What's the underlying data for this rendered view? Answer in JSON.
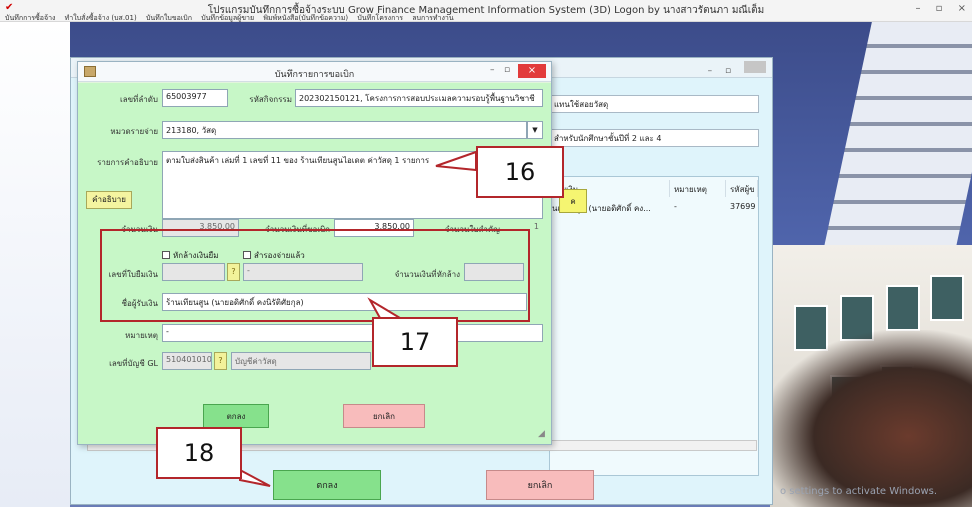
{
  "app": {
    "title": "โปรแกรมบันทึกการซื้อจ้างระบบ Grow Finance Management Information System (3D) Logon by นางสาวรัตนภา มณีเต็ม",
    "menu": [
      "บันทึกการซื้อจ้าง",
      "ทำใบสั่งซื้อจ้าง (บส.01)",
      "บันทึกใบขอเบิก",
      "บันทึกข้อมูลผู้ขาย",
      "พิมพ์หนังสือ(บันทึกข้อความ)",
      "บันทึกโครงการ",
      "ลบการทำงาน"
    ],
    "window_controls": [
      "–",
      "▫",
      "×"
    ]
  },
  "main_window": {
    "fields": [
      "แทนใช้สอยวัสดุ",
      "สำหรับนักศึกษาชั้นปีที่ 2 และ 4"
    ],
    "yellow_button": "ค",
    "table_headers": [
      "ผู้รับเงิน",
      "หมายเหตุ",
      "รหัสผู้ข"
    ],
    "table_row": [
      "นเทียนสูน (นายอดิศักดิ์ คง...",
      "-",
      "37699"
    ],
    "ok_label": "ตกลง",
    "cancel_label": "ยกเลิก",
    "watermark": "o settings to activate Windows."
  },
  "dialog": {
    "title": "บันทึกรายการขอเบิก",
    "controls": {
      "min": "–",
      "max": "▫",
      "close": "×"
    },
    "seq_label": "เลขที่ลำดับ",
    "seq_value": "65003977",
    "activity_label": "รหัสกิจกรรม",
    "activity_value": "202302150121, โครงการการสอบประเมลความรอบรู้พื้นฐานวิชาชี",
    "expense_label": "หมวดรายจ่าย",
    "expense_value": "213180, วัสดุ",
    "desc_label": "รายการคำอธิบาย",
    "desc_value": "ตามใบส่งสินค้า เล่มที่ 1  เลขที่ 11  ของ ร้านเทียนสูนไอเดต  ค่าวัสดุ 1 รายการ",
    "desc_button": "คำอธิบาย",
    "amount_label": "จำนวนเงิน",
    "amount_value": "3,850.00",
    "request_label": "จำนวนเงินที่ขอเบิก",
    "request_value": "3,850.00",
    "receipts_label": "จำนวนใบสำคัญ",
    "receipts_value": "1",
    "advance_check_label": "หักล้างเงินยืม",
    "paid_check_label": "สำรองจ่ายแล้ว",
    "loan_no_label": "เลขที่ใบยืมเงิน",
    "loan_dash": "-",
    "clear_amount_label": "จำนวนเงินที่หักล้าง",
    "payee_label": "ชื่อผู้รับเงิน",
    "payee_value": "ร้านเทียนสูน (นายอดิศักดิ์ คงนิรัติศัยกุล)",
    "remark_label": "หมายเหตุ",
    "remark_value": "-",
    "gl_label": "เลขที่บัญชี GL",
    "gl_value": "5104010104",
    "gl_name": "บัญชีค่าวัสดุ",
    "q_button": "?",
    "ok_label": "ตกลง",
    "cancel_label": "ยกเลิก"
  },
  "callouts": [
    "16",
    "17",
    "18"
  ],
  "colors": {
    "annotation_red": "#b3262b",
    "ok_green": "#86e18c",
    "cancel_pink": "#f8bcbc",
    "dialog_green": "#c7f7c7"
  }
}
